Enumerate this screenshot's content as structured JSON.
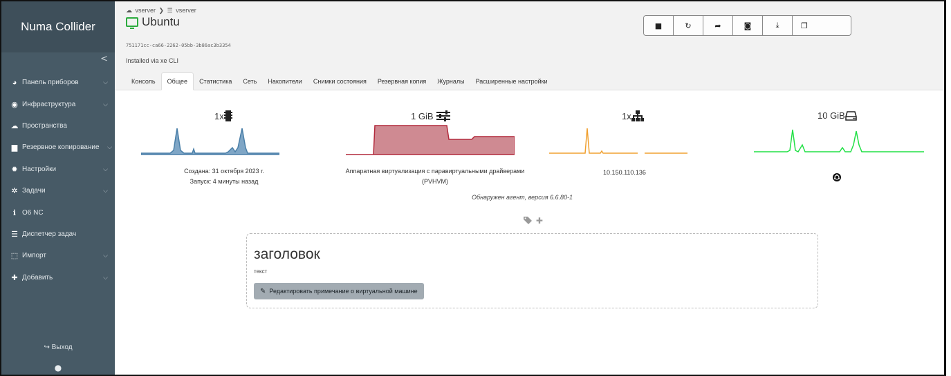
{
  "sidebar": {
    "brand": "Numa Collider",
    "collapse_glyph": "<",
    "items": [
      {
        "label": "Панель приборов",
        "icon": "dashboard-icon",
        "glyph": "◕",
        "has_submenu": true
      },
      {
        "label": "Инфраструктура",
        "icon": "globe-icon",
        "glyph": "◉",
        "has_submenu": true
      },
      {
        "label": "Пространства",
        "icon": "cloud-icon",
        "glyph": "☁",
        "has_submenu": false
      },
      {
        "label": "Резервное копирование",
        "icon": "archive-icon",
        "glyph": "▆",
        "has_submenu": true
      },
      {
        "label": "Настройки",
        "icon": "gear-icon",
        "glyph": "✹",
        "has_submenu": true
      },
      {
        "label": "Задачи",
        "icon": "gears-icon",
        "glyph": "✲",
        "has_submenu": true
      },
      {
        "label": "О6 NC",
        "icon": "info-icon",
        "glyph": "ℹ",
        "has_submenu": false
      },
      {
        "label": "Диспетчер задач",
        "icon": "task-list-icon",
        "glyph": "☰",
        "has_submenu": false
      },
      {
        "label": "Импорт",
        "icon": "import-icon",
        "glyph": "⬚",
        "has_submenu": true
      },
      {
        "label": "Добавить",
        "icon": "plus-icon",
        "glyph": "✚",
        "has_submenu": true
      }
    ],
    "chevron_glyph": "⌵",
    "logout_label": "Выход",
    "logout_glyph": "↪",
    "user_glyph": "●"
  },
  "header": {
    "breadcrumb_pool": "vserver",
    "breadcrumb_host": "vserver",
    "breadcrumb_sep": "❯",
    "vm_name": "Ubuntu",
    "uuid": "751171cc-ca66-2262-05bb-3b86ac3b3354",
    "install_note": "Installed via xe CLI",
    "toolbar": [
      {
        "name": "stop-button",
        "icon": "stop-icon",
        "glyph": "■"
      },
      {
        "name": "restart-button",
        "icon": "refresh-icon",
        "glyph": "↻"
      },
      {
        "name": "migrate-button",
        "icon": "share-icon",
        "glyph": "➦"
      },
      {
        "name": "snapshot-button",
        "icon": "camera-icon",
        "glyph": "◙"
      },
      {
        "name": "export-button",
        "icon": "download-icon",
        "glyph": "⤓"
      },
      {
        "name": "copy-button",
        "icon": "copy-icon",
        "glyph": "❐"
      }
    ],
    "tabs": [
      "Консоль",
      "Общее",
      "Статистика",
      "Сеть",
      "Накопители",
      "Снимки состояния",
      "Резервная копия",
      "Журналы",
      "Расширенные настройки"
    ],
    "active_tab": "Общее"
  },
  "stats": {
    "cpu_label": "1x",
    "memory_label": "1 GiB",
    "network_label": "1x",
    "disk_label": "10 GiB",
    "colors": {
      "cpu": "#4a7fa8",
      "memory": "#b22a3c",
      "network": "#f0a030",
      "disk": "#21e045"
    }
  },
  "details": {
    "created": "Создана: 31 октября 2023 г.",
    "started": "Запуск: 4 минуты назад",
    "virt_mode": "Аппаратная виртуализация с паравиртуальными драйверами",
    "virt_mode_short": "(PVHVM)",
    "ip": "10.150.110.136",
    "os_icon": "ubuntu-icon",
    "agent": "Обнаружен агент, версия 6.6.80-1"
  },
  "tags": {
    "glyph": "✚",
    "icon": "tags-icon"
  },
  "note": {
    "title": "заголовок",
    "text": "текст",
    "edit_label": "Редактировать примечание о виртуальной машине",
    "edit_icon": "pencil-icon"
  }
}
